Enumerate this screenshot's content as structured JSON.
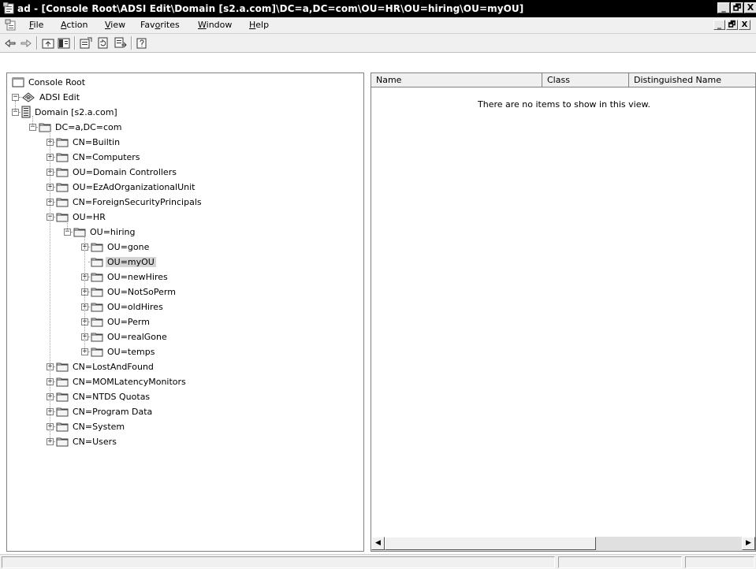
{
  "window": {
    "title": "ad - [Console Root\\ADSI Edit\\Domain [s2.a.com]\\DC=a,DC=com\\OU=HR\\OU=hiring\\OU=myOU]",
    "minimize": "_",
    "restore": "🗗",
    "close": "X"
  },
  "menubar": {
    "items": [
      {
        "label": "File",
        "accel": "F",
        "rest": "ile"
      },
      {
        "label": "Action",
        "accel": "A",
        "rest": "ction"
      },
      {
        "label": "View",
        "accel": "V",
        "rest": "iew"
      },
      {
        "label": "Favorites",
        "pre": "Fav",
        "accel": "o",
        "rest": "rites"
      },
      {
        "label": "Window",
        "accel": "W",
        "rest": "indow"
      },
      {
        "label": "Help",
        "accel": "H",
        "rest": "elp"
      }
    ],
    "mdi_min": "_",
    "mdi_restore": "🗗",
    "mdi_close": "X"
  },
  "toolbar": {
    "icons": [
      "back-arrow-icon",
      "forward-arrow-icon",
      "up-one-level-icon",
      "show-hide-console-tree-icon",
      "properties-icon",
      "refresh-icon",
      "export-list-icon",
      "help-icon"
    ]
  },
  "tree": {
    "nodes": [
      {
        "label": "Console Root",
        "level": 0,
        "expander": "none",
        "icon": "console-root-icon"
      },
      {
        "label": "ADSI Edit",
        "level": 0,
        "expander": "minus",
        "icon": "adsi-edit-icon"
      },
      {
        "label": "Domain [s2.a.com]",
        "level": 1,
        "expander": "minus",
        "icon": "server-icon"
      },
      {
        "label": "DC=a,DC=com",
        "level": 2,
        "expander": "minus",
        "icon": "folder-icon"
      },
      {
        "label": "CN=Builtin",
        "level": 3,
        "expander": "plus",
        "icon": "folder-icon"
      },
      {
        "label": "CN=Computers",
        "level": 3,
        "expander": "plus",
        "icon": "folder-icon"
      },
      {
        "label": "OU=Domain Controllers",
        "level": 3,
        "expander": "plus",
        "icon": "folder-icon"
      },
      {
        "label": "OU=EzAdOrganizationalUnit",
        "level": 3,
        "expander": "plus",
        "icon": "folder-icon"
      },
      {
        "label": "CN=ForeignSecurityPrincipals",
        "level": 3,
        "expander": "plus",
        "icon": "folder-icon"
      },
      {
        "label": "OU=HR",
        "level": 3,
        "expander": "minus",
        "icon": "folder-icon"
      },
      {
        "label": "OU=hiring",
        "level": 4,
        "expander": "minus",
        "icon": "folder-icon"
      },
      {
        "label": "OU=gone",
        "level": 5,
        "expander": "plus",
        "icon": "folder-icon"
      },
      {
        "label": "OU=myOU",
        "level": 5,
        "expander": "none",
        "icon": "folder-icon",
        "selected": true
      },
      {
        "label": "OU=newHires",
        "level": 5,
        "expander": "plus",
        "icon": "folder-icon"
      },
      {
        "label": "OU=NotSoPerm",
        "level": 5,
        "expander": "plus",
        "icon": "folder-icon"
      },
      {
        "label": "OU=oldHires",
        "level": 5,
        "expander": "plus",
        "icon": "folder-icon"
      },
      {
        "label": "OU=Perm",
        "level": 5,
        "expander": "plus",
        "icon": "folder-icon"
      },
      {
        "label": "OU=realGone",
        "level": 5,
        "expander": "plus",
        "icon": "folder-icon"
      },
      {
        "label": "OU=temps",
        "level": 5,
        "expander": "plus",
        "icon": "folder-icon"
      },
      {
        "label": "CN=LostAndFound",
        "level": 3,
        "expander": "plus",
        "icon": "folder-icon"
      },
      {
        "label": "CN=MOMLatencyMonitors",
        "level": 3,
        "expander": "plus",
        "icon": "folder-icon"
      },
      {
        "label": "CN=NTDS Quotas",
        "level": 3,
        "expander": "plus",
        "icon": "folder-icon"
      },
      {
        "label": "CN=Program Data",
        "level": 3,
        "expander": "plus",
        "icon": "folder-icon"
      },
      {
        "label": "CN=System",
        "level": 3,
        "expander": "plus",
        "icon": "folder-icon"
      },
      {
        "label": "CN=Users",
        "level": 3,
        "expander": "plus",
        "icon": "folder-icon"
      }
    ]
  },
  "list": {
    "columns": [
      "Name",
      "Class",
      "Distinguished Name"
    ],
    "empty_message": "There are no items to show in this view."
  },
  "colors": {
    "titlebar_bg": "#000000",
    "selection_bg": "#d4d4d4",
    "chrome_bg": "#f0f0f0"
  }
}
